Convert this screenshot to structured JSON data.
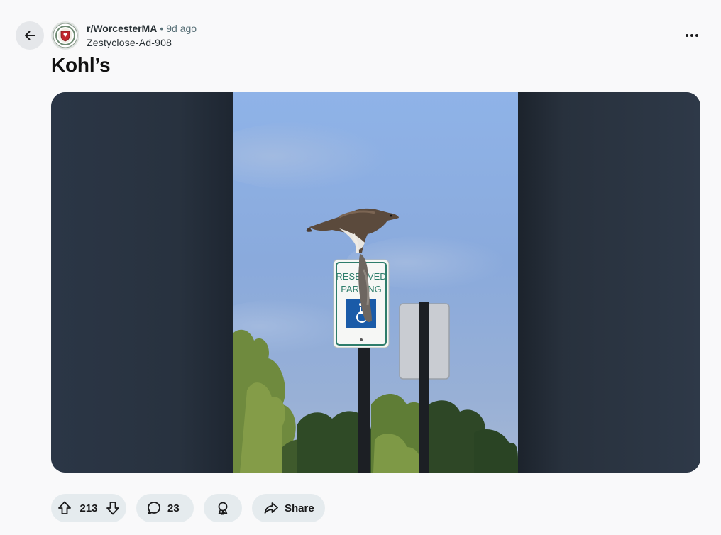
{
  "post": {
    "subreddit": "r/WorcesterMA",
    "separator": "•",
    "age": "9d ago",
    "author": "Zestyclose-Ad-908",
    "title": "Kohl’s"
  },
  "photo": {
    "sign_line1": "RESERVED",
    "sign_line2": "PARKING",
    "sign_accent": "#1a5ba8",
    "sign_border": "#2e7d6b"
  },
  "actions": {
    "upvotes": "213",
    "comments": "23",
    "share_label": "Share"
  },
  "icons": {
    "back": "arrow-left-icon",
    "more": "ellipsis-icon",
    "upvote": "upvote-arrow-icon",
    "downvote": "downvote-arrow-icon",
    "comment": "comment-bubble-icon",
    "award": "award-icon",
    "share": "share-arrow-icon"
  },
  "colors": {
    "page_bg": "#f9f9fa",
    "pill_bg": "#e5ebee",
    "media_bg": "#27323f"
  }
}
